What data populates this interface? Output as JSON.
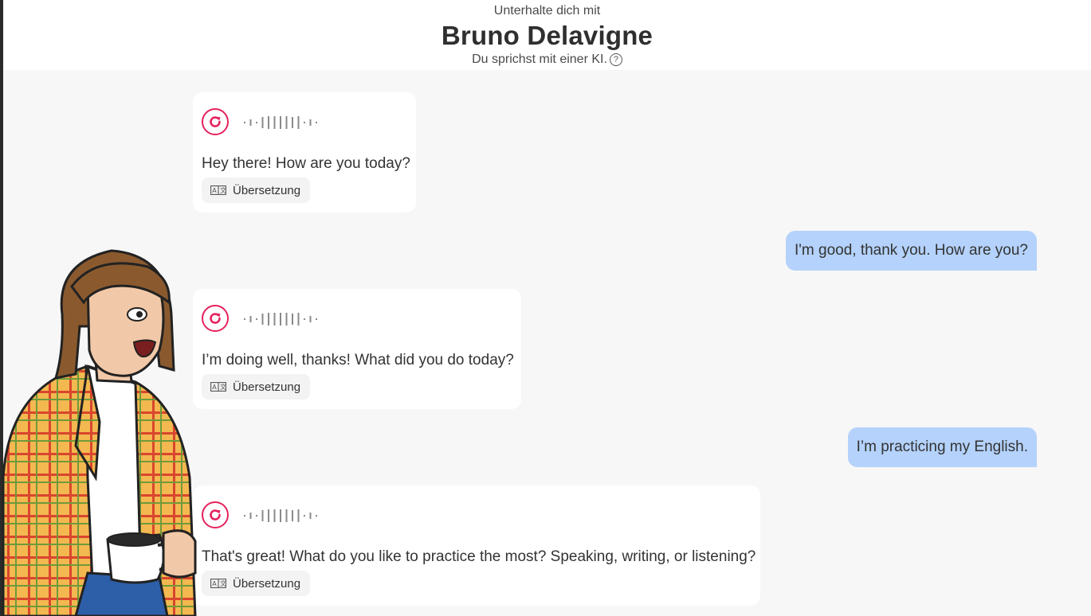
{
  "header": {
    "pretitle": "Unterhalte dich mit",
    "name": "Bruno Delavigne",
    "subtitle": "Du sprichst mit einer KI.",
    "help_icon": "?"
  },
  "messages": [
    {
      "role": "ai",
      "text": "Hey there! How are you today?",
      "translate_label": "Übersetzung"
    },
    {
      "role": "user",
      "text": "I'm good, thank you. How are you?"
    },
    {
      "role": "ai",
      "text": "I’m doing well, thanks! What did you do today?",
      "translate_label": "Übersetzung"
    },
    {
      "role": "user",
      "text": "I’m practicing my English."
    },
    {
      "role": "ai",
      "text": "That's great! What do you like to practice the most? Speaking, writing, or listening?",
      "translate_label": "Übersetzung"
    }
  ],
  "icons": {
    "replay": "replay-icon",
    "waveform": "audio-waveform-icon",
    "translate": "translate-icon",
    "help": "help-circle-icon"
  },
  "colors": {
    "accent": "#e5225d",
    "user_bubble": "#b4d2fb",
    "ai_bubble": "#ffffff",
    "background": "#f7f7f7"
  }
}
